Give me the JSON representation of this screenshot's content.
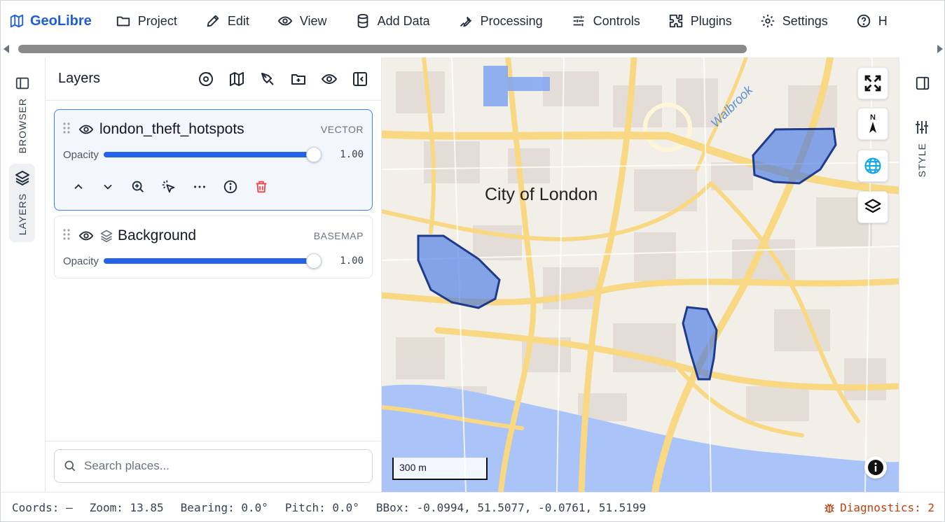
{
  "app": {
    "name": "GeoLibre",
    "accent": "#1d5fd6"
  },
  "menu": [
    {
      "label": "Project",
      "icon": "folder-icon"
    },
    {
      "label": "Edit",
      "icon": "pencil-icon"
    },
    {
      "label": "View",
      "icon": "eye-icon"
    },
    {
      "label": "Add Data",
      "icon": "database-icon"
    },
    {
      "label": "Processing",
      "icon": "wrench-icon"
    },
    {
      "label": "Controls",
      "icon": "sliders-icon"
    },
    {
      "label": "Plugins",
      "icon": "puzzle-icon"
    },
    {
      "label": "Settings",
      "icon": "gear-icon"
    },
    {
      "label": "H",
      "icon": "help-icon"
    }
  ],
  "rail": {
    "browser_label": "BROWSER",
    "layers_label": "LAYERS"
  },
  "panel": {
    "title": "Layers",
    "layers": [
      {
        "name": "london_theft_hotspots",
        "type": "VECTOR",
        "opacity_label": "Opacity",
        "opacity": 1.0,
        "opacity_text": "1.00"
      },
      {
        "name": "Background",
        "type": "BASEMAP",
        "opacity_label": "Opacity",
        "opacity": 1.0,
        "opacity_text": "1.00"
      }
    ],
    "search_placeholder": "Search places..."
  },
  "map": {
    "place_label": "City of London",
    "river_label": "Walbrook",
    "scale_label": "300 m",
    "compass_label": "N",
    "hotspot_color": "#3b6fe6"
  },
  "right_rail": {
    "style_label": "STYLE"
  },
  "status": {
    "coords": "Coords: —",
    "zoom": "Zoom: 13.85",
    "bearing": "Bearing: 0.0°",
    "pitch": "Pitch: 0.0°",
    "bbox": "BBox: -0.0994, 51.5077, -0.0761, 51.5199",
    "diagnostics": "Diagnostics: 2"
  }
}
